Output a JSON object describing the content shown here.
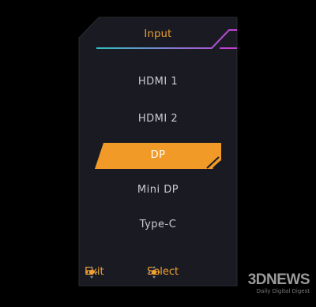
{
  "osd": {
    "title": "Input",
    "items": [
      {
        "label": "HDMI 1",
        "selected": false
      },
      {
        "label": "HDMI 2",
        "selected": false
      },
      {
        "label": "DP",
        "selected": true
      },
      {
        "label": "Mini DP",
        "selected": false
      },
      {
        "label": "Type-C",
        "selected": false
      }
    ],
    "footer": {
      "exit_label": "Exit",
      "exit_icon": "dpad-left-icon",
      "select_label": "Select",
      "select_icon": "dpad-right-icon"
    }
  },
  "watermark": {
    "brand": "3DNEWS",
    "subtitle": "Daily Digital Digest"
  },
  "colors": {
    "accent_orange": "#f0a030",
    "accent_magenta": "#c040d0",
    "accent_teal": "#30c0c0",
    "panel_bg": "#1a1b22",
    "item_text": "#c9ccd2"
  }
}
